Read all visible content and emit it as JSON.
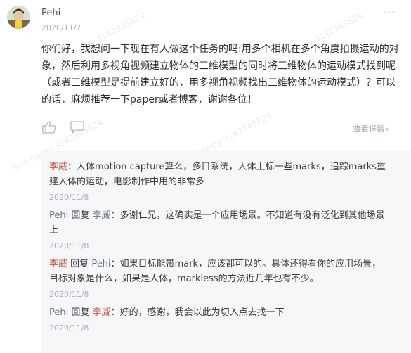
{
  "post": {
    "author": "Pehi",
    "date": "2020/11/7",
    "body": "你们好，我想问一下现在有人做这个任务的吗:用多个相机在多个角度拍摄运动的对象，然后利用多视角视频建立物体的三维模型的同时将三维物体的运动模式找到呢（或者三维模型是提前建立好的，用多视角视频找出三维物体的运动模式）？可以的话，麻烦推荐一下paper或者博客，谢谢各位！",
    "view_detail_label": "查看详情",
    "view_detail_chevron": "›",
    "more_label": "···"
  },
  "replies": [
    {
      "author": "李威",
      "reply_word": "",
      "reply_to": "",
      "sep": "：",
      "text": "人体motion capture算么，多目系统，人体上标一些marks，追踪marks重建人体的运动，电影制作中用的非常多",
      "date": "2020/11/8"
    },
    {
      "author": "Pehi",
      "reply_word": "回复",
      "reply_to": "李威",
      "sep": "：",
      "text": "多谢仁兄，这确实是一个应用场景。不知道有没有泛化到其他场景上",
      "date": "2020/11/8"
    },
    {
      "author": "李威",
      "reply_word": "回复",
      "reply_to": "Pehi",
      "sep": "：",
      "text": "如果目标能带mark，应该都可以的。具体还得看你的应用场景，目标对象是什么，如果是人体，markless的方法近几年也有不少。",
      "date": "2020/11/8"
    },
    {
      "author": "Pehi",
      "reply_word": "回复",
      "reply_to": "李威",
      "sep": "：",
      "text": "好的，感谢，我会以此为切入点去找一下",
      "date": "2020/11/8"
    }
  ],
  "watermark_text": "Tom Hardy 3142345824",
  "colors": {
    "name_red": "#c9553f",
    "name_gray": "#6a7785",
    "date_gray": "#aab0b6",
    "reply_bg": "#f6f7f9"
  },
  "icons": [
    "avatar",
    "more-icon",
    "like-icon",
    "comment-icon",
    "chevron-right-icon"
  ]
}
